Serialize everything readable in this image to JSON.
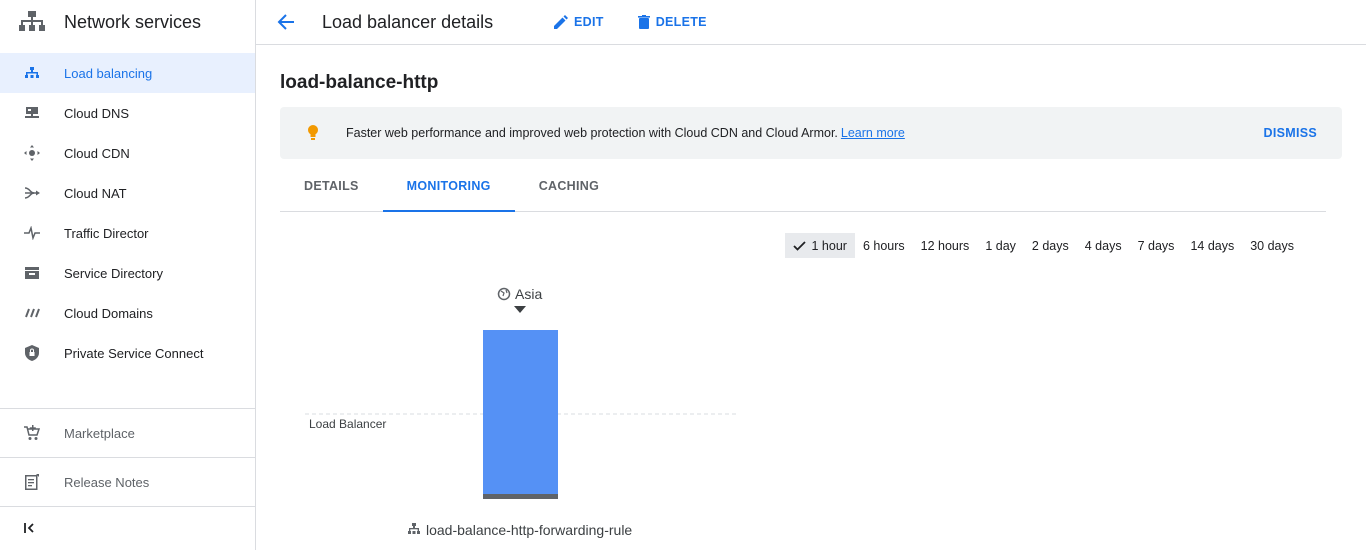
{
  "sidebar": {
    "title": "Network services",
    "items": [
      {
        "label": "Load balancing",
        "icon": "load-balancing-icon",
        "active": true
      },
      {
        "label": "Cloud DNS",
        "icon": "cloud-dns-icon"
      },
      {
        "label": "Cloud CDN",
        "icon": "cloud-cdn-icon"
      },
      {
        "label": "Cloud NAT",
        "icon": "cloud-nat-icon"
      },
      {
        "label": "Traffic Director",
        "icon": "traffic-director-icon"
      },
      {
        "label": "Service Directory",
        "icon": "service-directory-icon"
      },
      {
        "label": "Cloud Domains",
        "icon": "cloud-domains-icon"
      },
      {
        "label": "Private Service Connect",
        "icon": "shield-lock-icon"
      }
    ],
    "bottom": [
      {
        "label": "Marketplace",
        "icon": "cart-icon"
      },
      {
        "label": "Release Notes",
        "icon": "notes-icon"
      }
    ]
  },
  "topbar": {
    "title": "Load balancer details",
    "edit_label": "EDIT",
    "delete_label": "DELETE"
  },
  "lb_name": "load-balance-http",
  "banner": {
    "message": "Faster web performance and improved web protection with Cloud CDN and Cloud Armor.",
    "link": "Learn more",
    "dismiss": "DISMISS"
  },
  "tabs": [
    {
      "label": "DETAILS"
    },
    {
      "label": "MONITORING",
      "active": true
    },
    {
      "label": "CACHING"
    }
  ],
  "time_ranges": [
    "1 hour",
    "6 hours",
    "12 hours",
    "1 day",
    "2 days",
    "4 days",
    "7 days",
    "14 days",
    "30 days"
  ],
  "selected_range": "1 hour",
  "topology": {
    "region": "Asia",
    "row_label": "Load Balancer",
    "forwarding_rule": "load-balance-http-forwarding-rule"
  },
  "colors": {
    "accent": "#1a73e8",
    "bar": "#5591f5",
    "bulb": "#f29900"
  }
}
